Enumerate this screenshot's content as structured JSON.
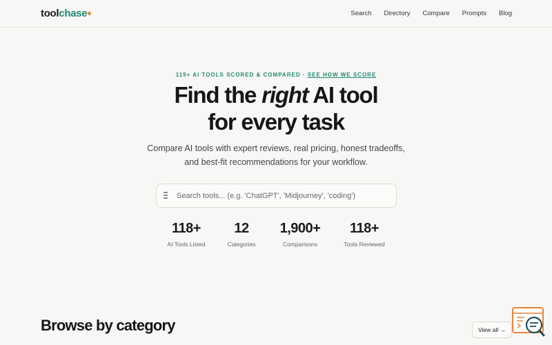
{
  "header": {
    "logo_part1": "tool",
    "logo_part2": "chase",
    "nav": [
      "Search",
      "Directory",
      "Compare",
      "Prompts",
      "Blog"
    ]
  },
  "hero": {
    "eyebrow_text": "119+ AI TOOLS SCORED & COMPARED · ",
    "eyebrow_link": "SEE HOW WE SCORE",
    "headline_before": "Find the ",
    "headline_italic": "right",
    "headline_after": " AI tool",
    "headline_line2": "for every task",
    "subtitle_line1": "Compare AI tools with expert reviews, real pricing, honest tradeoffs,",
    "subtitle_line2": "and best-fit recommendations for your workflow."
  },
  "search": {
    "placeholder": "Search tools... (e.g. 'ChatGPT', 'Midjourney', 'coding')"
  },
  "stats": [
    {
      "value": "118+",
      "label": "AI Tools Listed"
    },
    {
      "value": "12",
      "label": "Categories"
    },
    {
      "value": "1,900+",
      "label": "Comparisons"
    },
    {
      "value": "118+",
      "label": "Tools Reviewed"
    }
  ],
  "browse": {
    "title": "Browse by category",
    "view_all": "View all →"
  },
  "colors": {
    "accent": "#1f8a73",
    "logo_dot": "#e8833a",
    "widget": "#e8833a",
    "background": "#f7f7f5"
  },
  "icons": {
    "search": "menu-lines-icon",
    "widget": "search-chat-widget-icon"
  }
}
